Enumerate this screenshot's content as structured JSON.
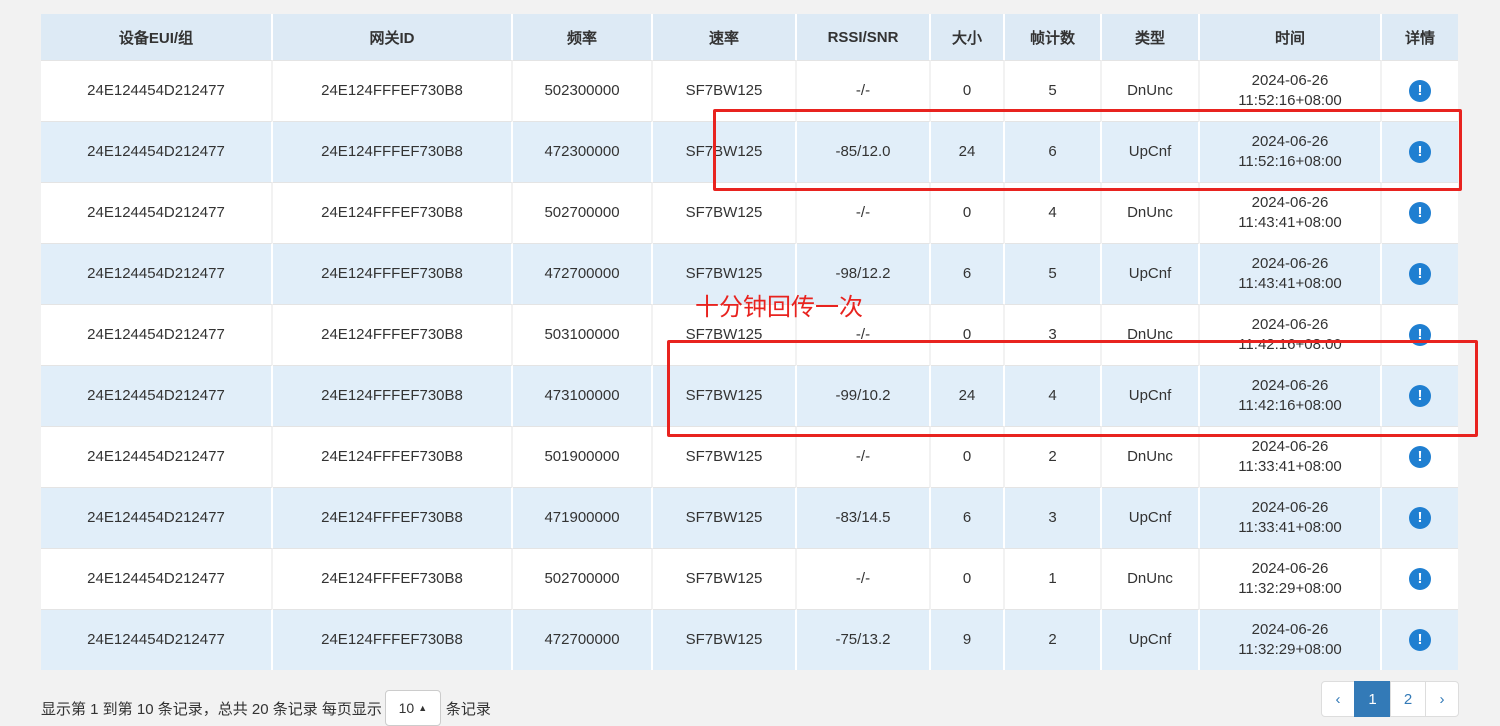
{
  "table": {
    "headers": [
      "设备EUI/组",
      "网关ID",
      "频率",
      "速率",
      "RSSI/SNR",
      "大小",
      "帧计数",
      "类型",
      "时间",
      "详情"
    ],
    "rows": [
      {
        "eui": "24E124454D212477",
        "gateway": "24E124FFFEF730B8",
        "freq": "502300000",
        "rate": "SF7BW125",
        "rssi": "-/-",
        "size": "0",
        "fcnt": "5",
        "type": "DnUnc",
        "date": "2024-06-26",
        "time": "11:52:16+08:00"
      },
      {
        "eui": "24E124454D212477",
        "gateway": "24E124FFFEF730B8",
        "freq": "472300000",
        "rate": "SF7BW125",
        "rssi": "-85/12.0",
        "size": "24",
        "fcnt": "6",
        "type": "UpCnf",
        "date": "2024-06-26",
        "time": "11:52:16+08:00"
      },
      {
        "eui": "24E124454D212477",
        "gateway": "24E124FFFEF730B8",
        "freq": "502700000",
        "rate": "SF7BW125",
        "rssi": "-/-",
        "size": "0",
        "fcnt": "4",
        "type": "DnUnc",
        "date": "2024-06-26",
        "time": "11:43:41+08:00"
      },
      {
        "eui": "24E124454D212477",
        "gateway": "24E124FFFEF730B8",
        "freq": "472700000",
        "rate": "SF7BW125",
        "rssi": "-98/12.2",
        "size": "6",
        "fcnt": "5",
        "type": "UpCnf",
        "date": "2024-06-26",
        "time": "11:43:41+08:00"
      },
      {
        "eui": "24E124454D212477",
        "gateway": "24E124FFFEF730B8",
        "freq": "503100000",
        "rate": "SF7BW125",
        "rssi": "-/-",
        "size": "0",
        "fcnt": "3",
        "type": "DnUnc",
        "date": "2024-06-26",
        "time": "11:42:16+08:00"
      },
      {
        "eui": "24E124454D212477",
        "gateway": "24E124FFFEF730B8",
        "freq": "473100000",
        "rate": "SF7BW125",
        "rssi": "-99/10.2",
        "size": "24",
        "fcnt": "4",
        "type": "UpCnf",
        "date": "2024-06-26",
        "time": "11:42:16+08:00"
      },
      {
        "eui": "24E124454D212477",
        "gateway": "24E124FFFEF730B8",
        "freq": "501900000",
        "rate": "SF7BW125",
        "rssi": "-/-",
        "size": "0",
        "fcnt": "2",
        "type": "DnUnc",
        "date": "2024-06-26",
        "time": "11:33:41+08:00"
      },
      {
        "eui": "24E124454D212477",
        "gateway": "24E124FFFEF730B8",
        "freq": "471900000",
        "rate": "SF7BW125",
        "rssi": "-83/14.5",
        "size": "6",
        "fcnt": "3",
        "type": "UpCnf",
        "date": "2024-06-26",
        "time": "11:33:41+08:00"
      },
      {
        "eui": "24E124454D212477",
        "gateway": "24E124FFFEF730B8",
        "freq": "502700000",
        "rate": "SF7BW125",
        "rssi": "-/-",
        "size": "0",
        "fcnt": "1",
        "type": "DnUnc",
        "date": "2024-06-26",
        "time": "11:32:29+08:00"
      },
      {
        "eui": "24E124454D212477",
        "gateway": "24E124FFFEF730B8",
        "freq": "472700000",
        "rate": "SF7BW125",
        "rssi": "-75/13.2",
        "size": "9",
        "fcnt": "2",
        "type": "UpCnf",
        "date": "2024-06-26",
        "time": "11:32:29+08:00"
      }
    ],
    "detail_icon": "info-circle-icon",
    "detail_glyph": "!"
  },
  "annotation": {
    "text": "十分钟回传一次",
    "color": "#e8231f"
  },
  "footer": {
    "summary": "显示第 1 到第 10 条记录，总共 20 条记录 每页显示",
    "page_size": "10",
    "page_size_suffix": "条记录"
  },
  "pagination": {
    "prev": "‹",
    "pages": [
      "1",
      "2"
    ],
    "active": "1",
    "next": "›"
  },
  "colors": {
    "header_bg": "#ddeaf5",
    "stripe_bg": "#e1eef9",
    "accent": "#337ab7",
    "icon": "#1f7fd1"
  }
}
